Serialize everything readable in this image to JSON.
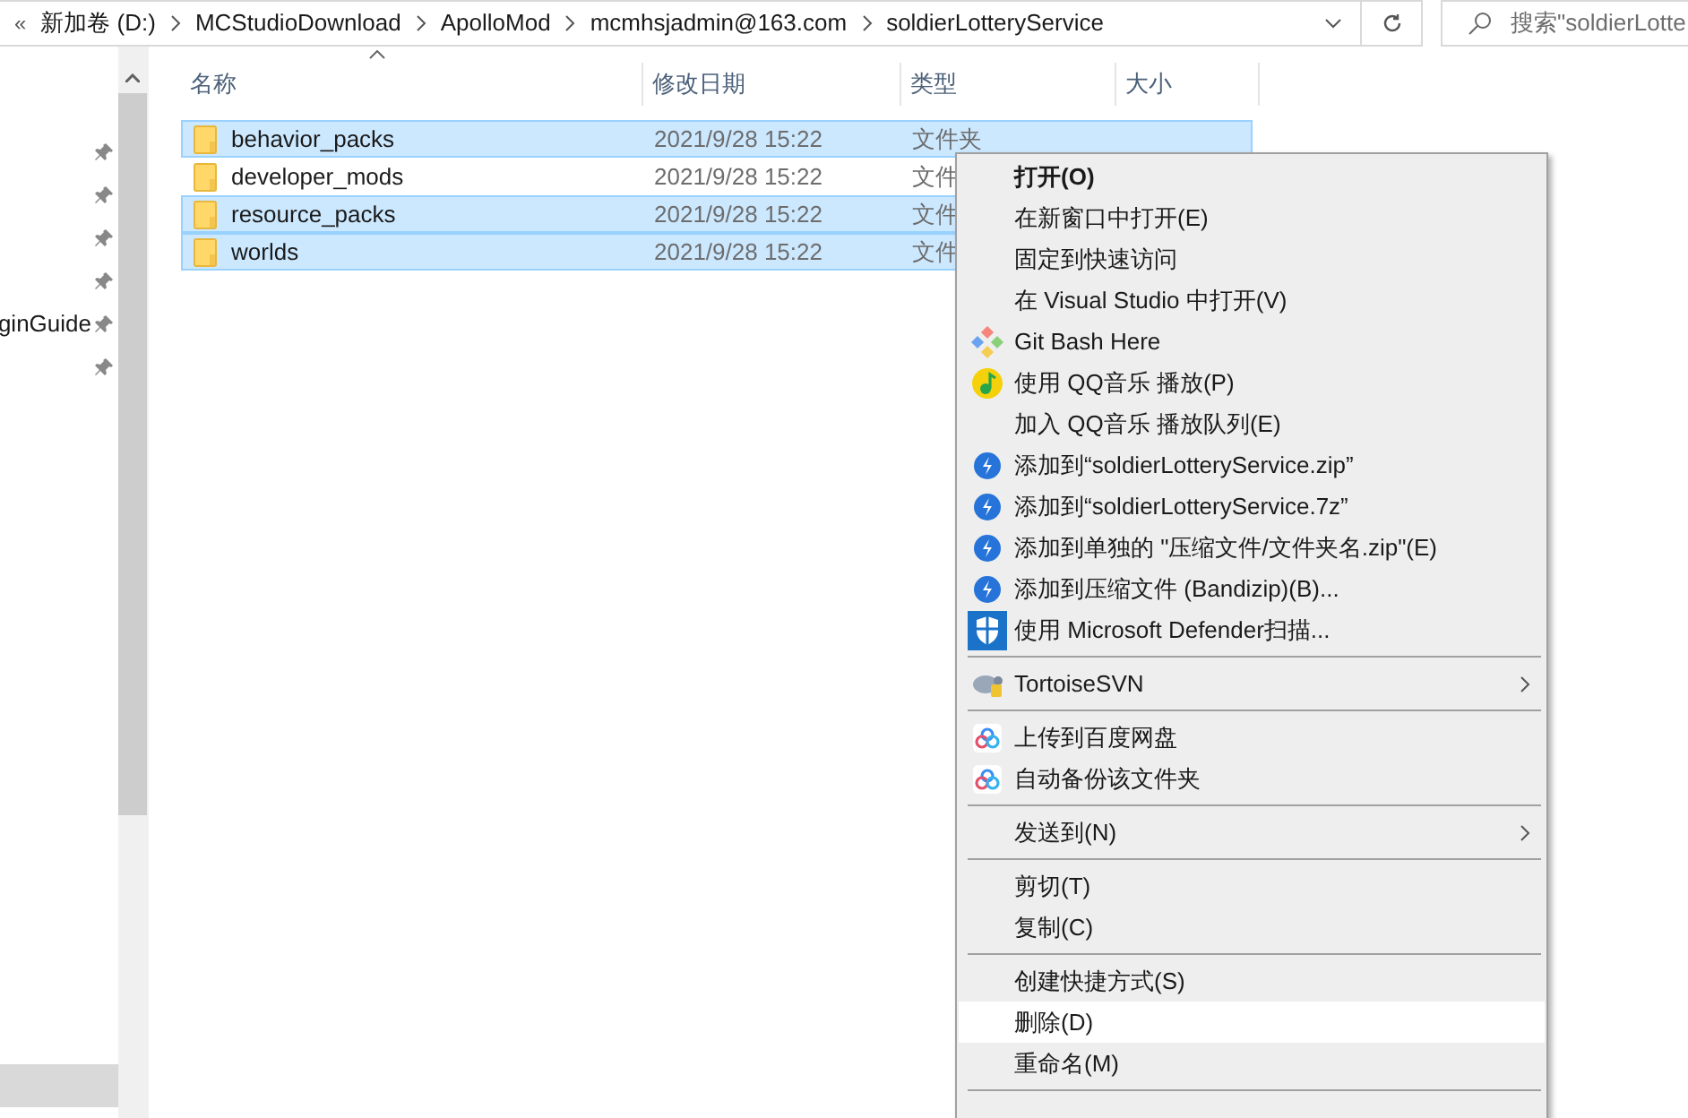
{
  "address_bar": {
    "overflow": "«",
    "crumbs": [
      "新加卷 (D:)",
      "MCStudioDownload",
      "ApolloMod",
      "mcmhsjadmin@163.com",
      "soldierLotteryService"
    ]
  },
  "search": {
    "placeholder": "搜索\"soldierLotte"
  },
  "nav_pane": {
    "items": [
      {
        "pinned": true,
        "selected": false
      },
      {
        "pinned": true,
        "selected": false
      },
      {
        "pinned": true,
        "selected": false
      },
      {
        "pinned": true,
        "selected": false
      },
      {
        "label": "ginGuide",
        "pinned": true,
        "selected": false
      },
      {
        "pinned": true,
        "selected": false
      }
    ]
  },
  "table": {
    "columns": [
      "名称",
      "修改日期",
      "类型",
      "大小"
    ],
    "rows": [
      {
        "name": "behavior_packs",
        "date": "2021/9/28 15:22",
        "type": "文件夹",
        "selected": true
      },
      {
        "name": "developer_mods",
        "date": "2021/9/28 15:22",
        "type": "文件",
        "selected": false
      },
      {
        "name": "resource_packs",
        "date": "2021/9/28 15:22",
        "type": "文件",
        "selected": true
      },
      {
        "name": "worlds",
        "date": "2021/9/28 15:22",
        "type": "文件",
        "selected": true
      }
    ]
  },
  "context_menu": {
    "items": [
      {
        "kind": "plain",
        "label": "打开(O)",
        "bold": true,
        "selected": false,
        "submenu": false
      },
      {
        "kind": "plain",
        "label": "在新窗口中打开(E)",
        "selected": false,
        "submenu": false
      },
      {
        "kind": "plain",
        "label": "固定到快速访问",
        "selected": false,
        "submenu": false
      },
      {
        "kind": "plain",
        "label": "在 Visual Studio 中打开(V)",
        "selected": false,
        "submenu": false
      },
      {
        "kind": "git",
        "label": "Git Bash Here",
        "selected": false,
        "submenu": false
      },
      {
        "kind": "music",
        "label": "使用 QQ音乐 播放(P)",
        "selected": false,
        "submenu": false
      },
      {
        "kind": "plain",
        "label": "加入 QQ音乐 播放队列(E)",
        "selected": false,
        "submenu": false
      },
      {
        "kind": "zip",
        "label": "添加到“soldierLotteryService.zip”",
        "selected": false,
        "submenu": false
      },
      {
        "kind": "zip",
        "label": "添加到“soldierLotteryService.7z”",
        "selected": false,
        "submenu": false
      },
      {
        "kind": "zip",
        "label": "添加到单独的 \"压缩文件/文件夹名.zip\"(E)",
        "selected": false,
        "submenu": false
      },
      {
        "kind": "zip",
        "label": "添加到压缩文件 (Bandizip)(B)...",
        "selected": false,
        "submenu": false
      },
      {
        "kind": "shield",
        "label": "使用 Microsoft Defender扫描...",
        "selected": false,
        "submenu": false
      },
      {
        "kind": "separator"
      },
      {
        "kind": "svn",
        "label": "TortoiseSVN",
        "selected": false,
        "submenu": true
      },
      {
        "kind": "separator"
      },
      {
        "kind": "cloud",
        "label": "上传到百度网盘",
        "selected": false,
        "submenu": false
      },
      {
        "kind": "cloud",
        "label": "自动备份该文件夹",
        "selected": false,
        "submenu": false
      },
      {
        "kind": "separator"
      },
      {
        "kind": "plain",
        "label": "发送到(N)",
        "selected": false,
        "submenu": true
      },
      {
        "kind": "separator"
      },
      {
        "kind": "plain",
        "label": "剪切(T)",
        "selected": false,
        "submenu": false
      },
      {
        "kind": "plain",
        "label": "复制(C)",
        "selected": false,
        "submenu": false
      },
      {
        "kind": "separator"
      },
      {
        "kind": "plain",
        "label": "创建快捷方式(S)",
        "selected": false,
        "submenu": false
      },
      {
        "kind": "plain",
        "label": "删除(D)",
        "selected": true,
        "submenu": false
      },
      {
        "kind": "plain",
        "label": "重命名(M)",
        "selected": false,
        "submenu": false
      },
      {
        "kind": "separator"
      }
    ]
  }
}
